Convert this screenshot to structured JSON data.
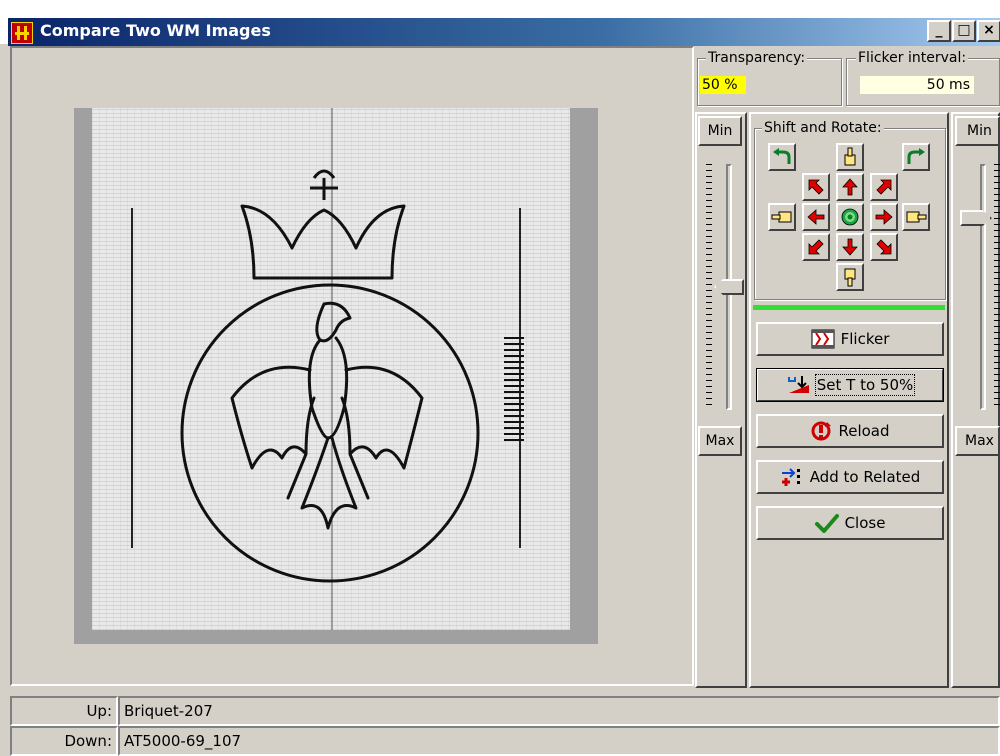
{
  "window": {
    "title": "Compare Two WM Images",
    "minimize_label": "_",
    "maximize_label": "□",
    "close_label": "×"
  },
  "controls": {
    "transparency_label": "Transparency:",
    "transparency_value": "50 %",
    "flicker_interval_label": "Flicker interval:",
    "flicker_interval_value": "50 ms",
    "shift_rotate_label": "Shift and Rotate:",
    "left_slider": {
      "min_label": "Min",
      "max_label": "Max",
      "level": 0.5
    },
    "right_slider": {
      "min_label": "Min",
      "max_label": "Max",
      "level": 0.22
    }
  },
  "buttons": {
    "flicker": "Flicker",
    "set_t": "Set T to 50%",
    "reload": "Reload",
    "add_related": "Add to Related",
    "close": "Close"
  },
  "status": {
    "up_label": "Up:",
    "up_value": "Briquet-207",
    "down_label": "Down:",
    "down_value": "AT5000-69_107"
  },
  "colors": {
    "titlebar_start": "#0a246a",
    "transparency_highlight": "#ffff00",
    "flicker_bg": "#ffffe1",
    "progress_green": "#33dd33",
    "arrow_red": "#e00000"
  }
}
